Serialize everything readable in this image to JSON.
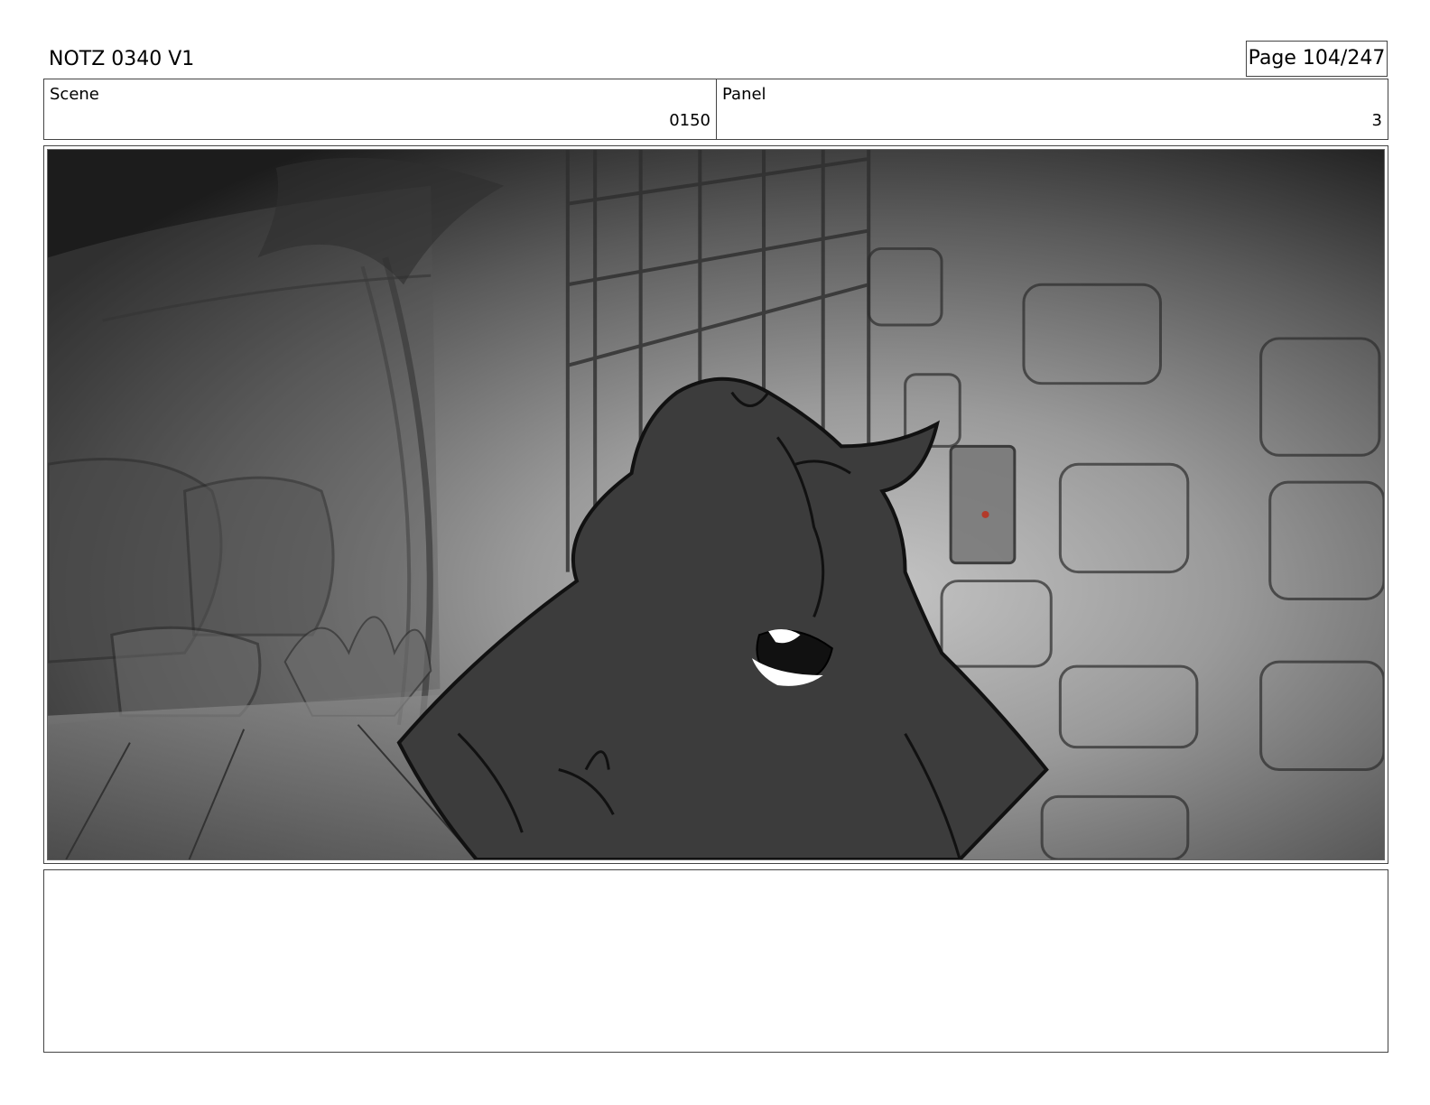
{
  "header": {
    "title": "NOTZ 0340 V1",
    "page": "Page 104/247"
  },
  "scene": {
    "label": "Scene",
    "value": "0150"
  },
  "panel": {
    "label": "Panel",
    "value": "3"
  },
  "notes": {
    "text": ""
  },
  "colors": {
    "border": "#444444",
    "sketch_dark": "#3a3a3a",
    "sketch_mid": "#7a7a7a",
    "sketch_light": "#b5b5b5"
  }
}
